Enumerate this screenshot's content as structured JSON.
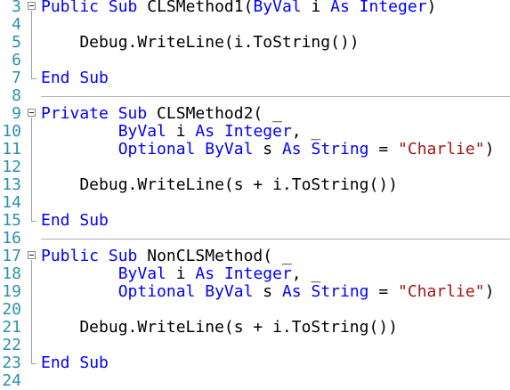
{
  "editor": {
    "lines": [
      {
        "num": "3",
        "tokens": [
          [
            "kw",
            "Public"
          ],
          [
            "t",
            " "
          ],
          [
            "kw",
            "Sub"
          ],
          [
            "t",
            " CLSMethod1("
          ],
          [
            "kw",
            "ByVal"
          ],
          [
            "t",
            " i "
          ],
          [
            "kw",
            "As"
          ],
          [
            "t",
            " "
          ],
          [
            "kw",
            "Integer"
          ],
          [
            "t",
            ")"
          ]
        ]
      },
      {
        "num": "4",
        "tokens": []
      },
      {
        "num": "5",
        "tokens": [
          [
            "t",
            "    Debug.WriteLine(i.ToString())"
          ]
        ]
      },
      {
        "num": "6",
        "tokens": []
      },
      {
        "num": "7",
        "tokens": [
          [
            "kw",
            "End"
          ],
          [
            "t",
            " "
          ],
          [
            "kw",
            "Sub"
          ]
        ]
      },
      {
        "num": "8",
        "tokens": []
      },
      {
        "num": "9",
        "tokens": [
          [
            "kw",
            "Private"
          ],
          [
            "t",
            " "
          ],
          [
            "kw",
            "Sub"
          ],
          [
            "t",
            " CLSMethod2( _"
          ]
        ]
      },
      {
        "num": "10",
        "tokens": [
          [
            "t",
            "        "
          ],
          [
            "kw",
            "ByVal"
          ],
          [
            "t",
            " i "
          ],
          [
            "kw",
            "As"
          ],
          [
            "t",
            " "
          ],
          [
            "kw",
            "Integer"
          ],
          [
            "t",
            ", _"
          ]
        ]
      },
      {
        "num": "11",
        "tokens": [
          [
            "t",
            "        "
          ],
          [
            "kw",
            "Optional"
          ],
          [
            "t",
            " "
          ],
          [
            "kw",
            "ByVal"
          ],
          [
            "t",
            " s "
          ],
          [
            "kw",
            "As"
          ],
          [
            "t",
            " "
          ],
          [
            "kw",
            "String"
          ],
          [
            "t",
            " = "
          ],
          [
            "str",
            "\"Charlie\""
          ],
          [
            "t",
            ")"
          ]
        ]
      },
      {
        "num": "12",
        "tokens": []
      },
      {
        "num": "13",
        "tokens": [
          [
            "t",
            "    Debug.WriteLine(s + i.ToString())"
          ]
        ]
      },
      {
        "num": "14",
        "tokens": []
      },
      {
        "num": "15",
        "tokens": [
          [
            "kw",
            "End"
          ],
          [
            "t",
            " "
          ],
          [
            "kw",
            "Sub"
          ]
        ]
      },
      {
        "num": "16",
        "tokens": []
      },
      {
        "num": "17",
        "tokens": [
          [
            "kw",
            "Public"
          ],
          [
            "t",
            " "
          ],
          [
            "kw",
            "Sub"
          ],
          [
            "t",
            " NonCLSMethod( _"
          ]
        ]
      },
      {
        "num": "18",
        "tokens": [
          [
            "t",
            "        "
          ],
          [
            "kw",
            "ByVal"
          ],
          [
            "t",
            " i "
          ],
          [
            "kw",
            "As"
          ],
          [
            "t",
            " "
          ],
          [
            "kw",
            "Integer"
          ],
          [
            "t",
            ", _"
          ]
        ]
      },
      {
        "num": "19",
        "tokens": [
          [
            "t",
            "        "
          ],
          [
            "kw",
            "Optional"
          ],
          [
            "t",
            " "
          ],
          [
            "kw",
            "ByVal"
          ],
          [
            "t",
            " s "
          ],
          [
            "kw",
            "As"
          ],
          [
            "t",
            " "
          ],
          [
            "kw",
            "String"
          ],
          [
            "t",
            " = "
          ],
          [
            "str",
            "\"Charlie\""
          ],
          [
            "t",
            ")"
          ]
        ]
      },
      {
        "num": "20",
        "tokens": []
      },
      {
        "num": "21",
        "tokens": [
          [
            "t",
            "    Debug.WriteLine(s + i.ToString())"
          ]
        ]
      },
      {
        "num": "22",
        "tokens": []
      },
      {
        "num": "23",
        "tokens": [
          [
            "kw",
            "End"
          ],
          [
            "t",
            " "
          ],
          [
            "kw",
            "Sub"
          ]
        ]
      },
      {
        "num": "24",
        "tokens": []
      }
    ],
    "colors": {
      "keyword": "#0000ff",
      "string": "#a31515",
      "line_number": "#2b91af",
      "text": "#000000"
    }
  }
}
